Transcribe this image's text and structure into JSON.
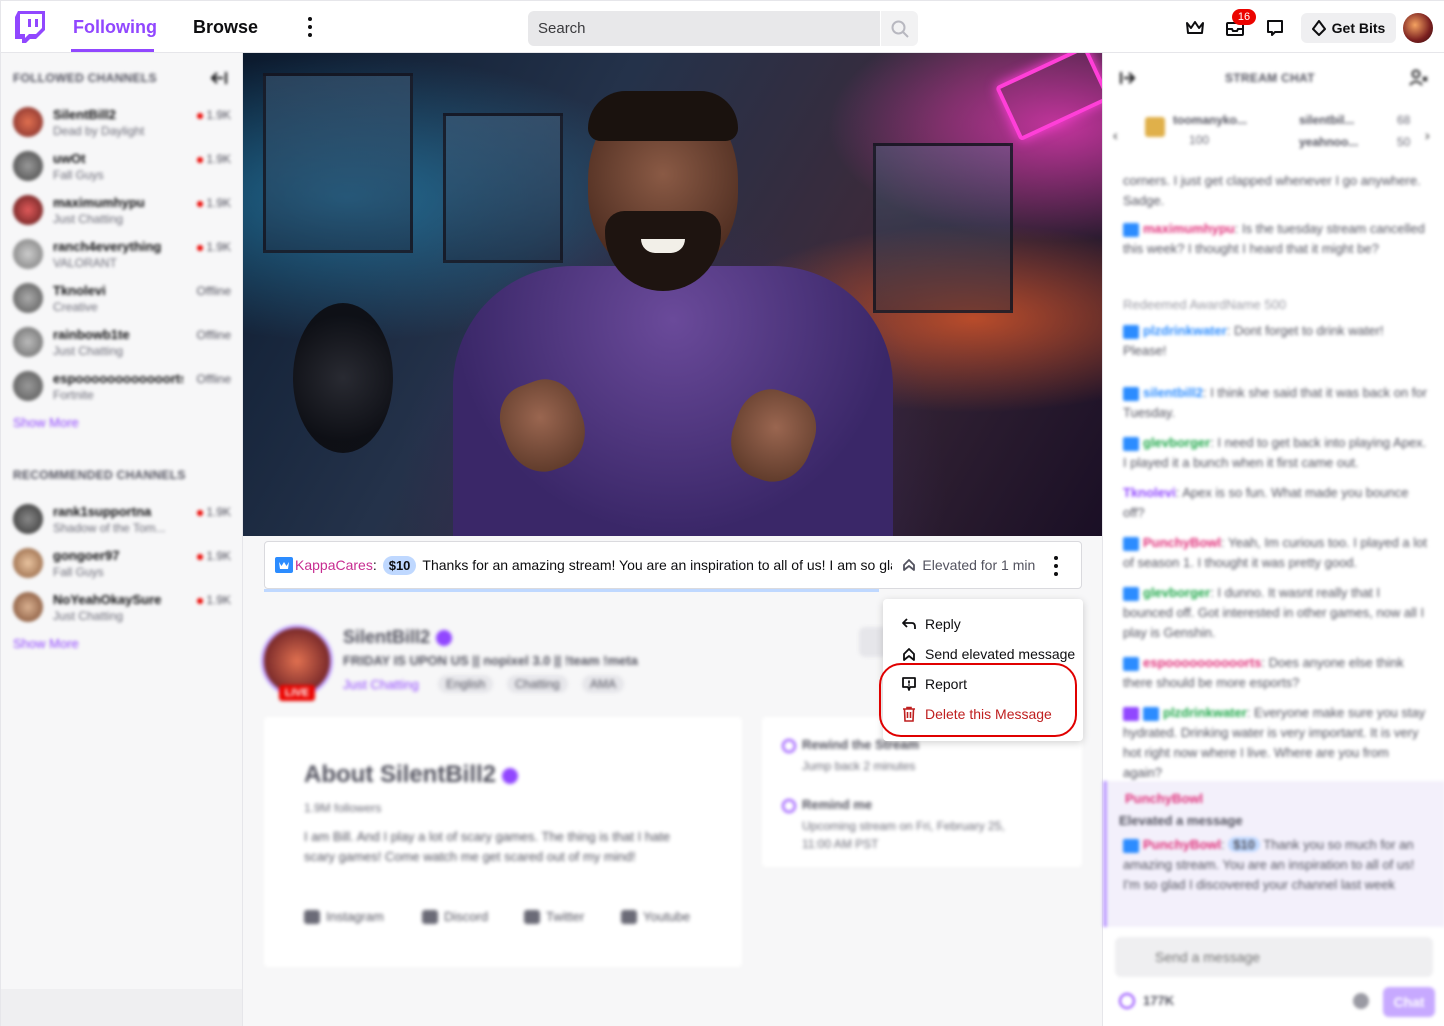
{
  "nav": {
    "following": "Following",
    "browse": "Browse",
    "search_placeholder": "Search",
    "notification_count": "16",
    "get_bits": "Get Bits"
  },
  "sidebar": {
    "followed_heading": "FOLLOWED CHANNELS",
    "followed": [
      {
        "name": "SilentBill2",
        "game": "Dead by Daylight",
        "count": "1.9K",
        "live": true
      },
      {
        "name": "uwOt",
        "game": "Fall Guys",
        "count": "1.9K",
        "live": true
      },
      {
        "name": "maximumhypu",
        "game": "Just Chatting",
        "count": "1.9K",
        "live": true
      },
      {
        "name": "ranch4everything",
        "game": "VALORANT",
        "count": "1.9K",
        "live": true
      },
      {
        "name": "Tknolevi",
        "game": "Creative",
        "count": "Offline",
        "live": false
      },
      {
        "name": "rainbowb1te",
        "game": "Just Chatting",
        "count": "Offline",
        "live": false
      },
      {
        "name": "espoooooooooooorts",
        "game": "Fortnite",
        "count": "Offline",
        "live": false
      }
    ],
    "show_more": "Show More",
    "recommended_heading": "RECOMMENDED CHANNELS",
    "recommended": [
      {
        "name": "rank1supportna",
        "game": "Shadow of the Tom...",
        "count": "1.9K"
      },
      {
        "name": "gongoer97",
        "game": "Fall Guys",
        "count": "1.9K"
      },
      {
        "name": "NoYeahOkaySure",
        "game": "Just Chatting",
        "count": "1.9K"
      }
    ]
  },
  "elevated": {
    "user": "KappaCares",
    "separator": ":",
    "amount": "$10",
    "message": "Thanks for an amazing stream! You are an inspiration to all of us! I am so glad",
    "status": "Elevated for 1 min"
  },
  "context_menu": {
    "reply": "Reply",
    "send_elevated": "Send elevated message",
    "report": "Report",
    "delete": "Delete this Message"
  },
  "channel": {
    "name": "SilentBill2",
    "title": "FRIDAY IS UPON US || nopixel 3.0 || !team !meta",
    "category": "Just Chatting",
    "tags": [
      "English",
      "Chatting",
      "AMA"
    ],
    "live": "LIVE",
    "about_title": "About SilentBill2",
    "followers": "1.9M followers",
    "bio": "I am Bill. And I play a lot of scary games. The thing is that I hate scary games! Come watch me get scared out of my mind!",
    "socials": [
      "Instagram",
      "Discord",
      "Twitter",
      "Youtube"
    ],
    "rewind_title": "Rewind the Stream",
    "rewind_sub": "Jump back 2 minutes",
    "remind_title": "Remind me",
    "remind_sub": "Upcoming stream on Fri, February 25, 11:00 AM PST"
  },
  "chat": {
    "title": "STREAM CHAT",
    "leaderboard": [
      {
        "name": "toomanyko...",
        "value": "100"
      },
      {
        "name": "silentbil...",
        "value": "68"
      },
      {
        "name": "yeahnoo...",
        "value": "50"
      }
    ],
    "messages": [
      {
        "user": "",
        "text": "corners. I just get clapped whenever I go anywhere. Sadge."
      },
      {
        "user": "maximumhypu",
        "text": "Is the tuesday stream cancelled this week? I thought I heard that it might be?"
      },
      {
        "user": "",
        "text": "Redeemed AwardName  500"
      },
      {
        "user": "plzdrinkwater",
        "text": "Dont forget to drink water! Please!"
      },
      {
        "user": "silentbill2",
        "text": "I think she said that it was back on for Tuesday."
      },
      {
        "user": "glevborger",
        "text": "I need to get back into playing Apex. I played it a bunch when it first came out."
      },
      {
        "user": "Tknolevi",
        "text": "Apex is so fun. What made you bounce off?"
      },
      {
        "user": "PunchyBowl",
        "text": "Yeah, Im curious too. I played a lot of season 1. I thought it was pretty good."
      },
      {
        "user": "glevborger",
        "text": "I dunno. It wasnt really that I bounced off. Got interested in other games, now all I play is Genshin."
      },
      {
        "user": "espoooooooooorts",
        "text": "Does anyone else think there should be more esports?"
      },
      {
        "user": "plzdrinkwater",
        "text": "Everyone make sure you stay hydrated. Drinking water is very important. It is very hot right now where I live. Where are you from again?"
      }
    ],
    "elevated_user": "PunchyBowl",
    "elevated_label": "Elevated a message",
    "elevated_amount": "$10",
    "elevated_text": "Thank you so much for an amazing stream. You are an inspiration to all of us! I'm so glad I discovered your channel last week",
    "input_placeholder": "Send a message",
    "points": "177K",
    "chat_button": "Chat"
  }
}
